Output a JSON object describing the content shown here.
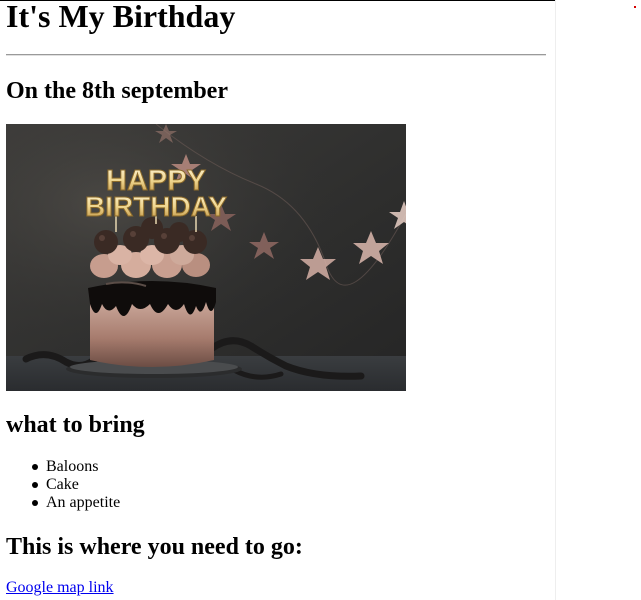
{
  "page": {
    "title": "It's My Birthday",
    "date_heading": "On the 8th september",
    "photo": {
      "alt": "Birthday cake",
      "topper_line1": "HAPPY",
      "topper_line2": "BIRTHDAY"
    },
    "bring_heading": "what to bring",
    "bring_items": [
      "Baloons",
      "Cake",
      "An appetite"
    ],
    "where_heading": "This is where you need to go:",
    "map_link_text": "Google map link"
  },
  "colors": {
    "text": "#000000",
    "link": "#0000ee",
    "rule": "#9a9a9a",
    "accent_dot": "#d40000"
  },
  "icons": {
    "list_bullet": "filled-circle"
  }
}
